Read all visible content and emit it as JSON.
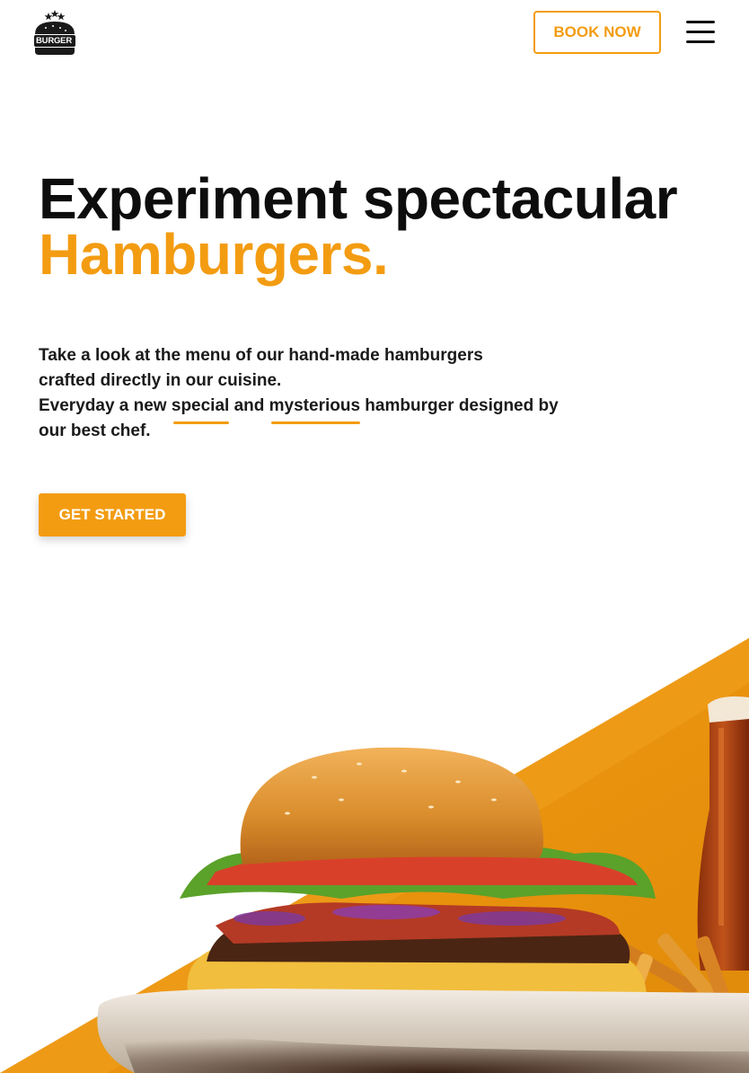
{
  "header": {
    "logo_text": "BURGER",
    "book_button": "BOOK NOW",
    "menu_icon": "hamburger-menu-icon"
  },
  "hero": {
    "title_line1": "Experiment spectacular",
    "title_line2": "Hamburgers.",
    "desc_line1": "Take a look at the menu of our hand-made hamburgers",
    "desc_line2": "crafted directly in our cuisine.",
    "desc3_a": "Everyday a new ",
    "desc3_special": "special",
    "desc3_and": " and ",
    "desc3_mysterious": "mysterious",
    "desc3_b": " hamburger designed by",
    "desc_line4": "our best chef.",
    "cta_button": "GET STARTED"
  },
  "colors": {
    "accent": "#f39c12",
    "text": "#111111",
    "background": "#ffffff"
  }
}
